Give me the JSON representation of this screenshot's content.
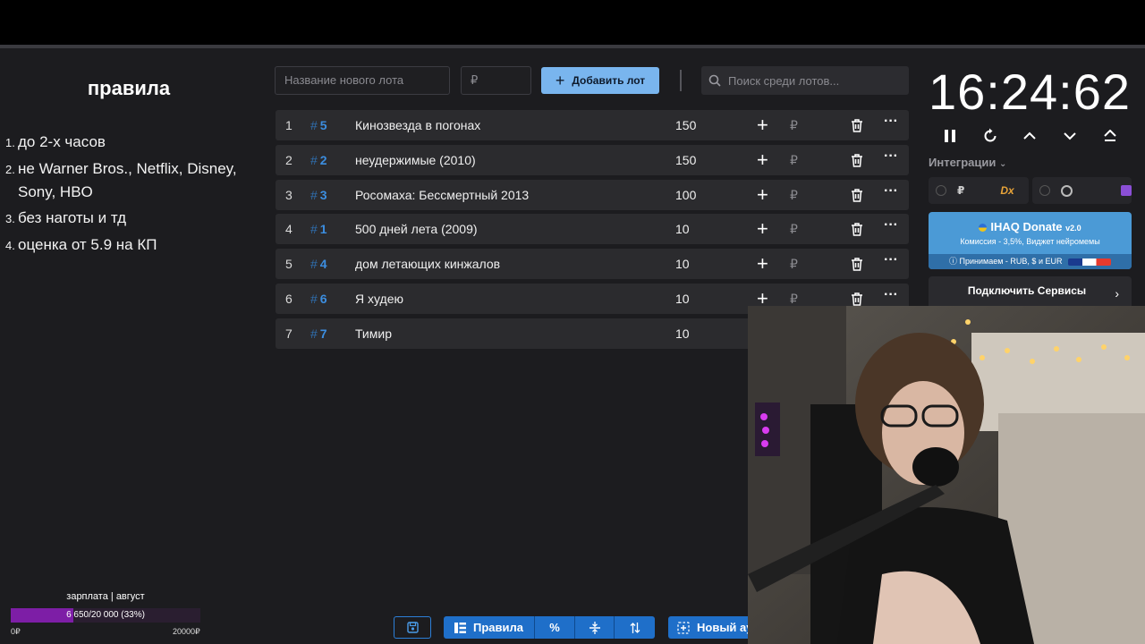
{
  "rules": {
    "title": "правила",
    "items": [
      {
        "num": "1.",
        "text": "до 2-х часов"
      },
      {
        "num": "2.",
        "text": "не Warner Bros., Netflix, Disney, Sony, HBO"
      },
      {
        "num": "3.",
        "text": "без наготы и тд"
      },
      {
        "num": "4.",
        "text": "оценка от 5.9 на КП"
      }
    ]
  },
  "controls": {
    "lot_name_placeholder": "Название нового лота",
    "amount_placeholder": "₽",
    "add_lot_label": "Добавить лот",
    "search_placeholder": "Поиск среди лотов..."
  },
  "lots": [
    {
      "idx": "1",
      "id": "5",
      "name": "Кинозвезда в погонах",
      "amount": "150",
      "currency": "₽"
    },
    {
      "idx": "2",
      "id": "2",
      "name": "неудержимые (2010)",
      "amount": "150",
      "currency": "₽"
    },
    {
      "idx": "3",
      "id": "3",
      "name": "Росомаха: Бессмертный 2013",
      "amount": "100",
      "currency": "₽"
    },
    {
      "idx": "4",
      "id": "1",
      "name": "500 дней лета (2009)",
      "amount": "10",
      "currency": "₽"
    },
    {
      "idx": "5",
      "id": "4",
      "name": "дом летающих кинжалов",
      "amount": "10",
      "currency": "₽"
    },
    {
      "idx": "6",
      "id": "6",
      "name": "Я худею",
      "amount": "10",
      "currency": "₽"
    },
    {
      "idx": "7",
      "id": "7",
      "name": "Тимир",
      "amount": "10",
      "currency": "₽"
    }
  ],
  "toolbar": {
    "rules_label": "Правила",
    "percent_label": "%",
    "new_auction_label": "Новый аук"
  },
  "timer": {
    "display": "16:24:62"
  },
  "integrations": {
    "label": "Интеграции",
    "currency": "₽",
    "dx_label": "Dx"
  },
  "donate": {
    "title": "IHAQ Donate",
    "version": "v2.0",
    "subtitle": "Комиссия - 3,5%, Виджет нейромемы",
    "footer": "Принимаем - RUB, $ и EUR"
  },
  "services": {
    "title": "Подключить Сервисы"
  },
  "salary": {
    "label": "зарплата | август",
    "progress_text": "6 650/20 000 (33%)",
    "progress": 0.33,
    "min": "0₽",
    "max": "20000₽"
  },
  "colors": {
    "accent": "#1f6fc9",
    "add_button": "#79b5ee",
    "salary_fill": "#7d1ea6",
    "id_blue": "#3c8ee0"
  }
}
